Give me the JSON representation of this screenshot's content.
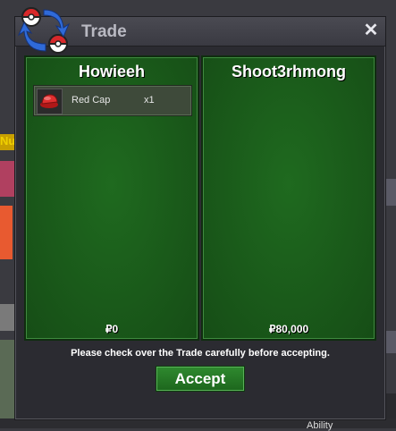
{
  "window": {
    "title": "Trade",
    "close_icon": "close-icon",
    "logo_icon": "trade-exchange-icon"
  },
  "trade": {
    "left": {
      "name": "Howieeh",
      "items": [
        {
          "name": "Red Cap",
          "quantity": "x1",
          "icon": "red-cap-icon"
        }
      ],
      "money": "₽0"
    },
    "right": {
      "name": "Shoot3rhmong",
      "items": [],
      "money": "₽80,000"
    }
  },
  "notice": "Please check over the Trade carefully before accepting.",
  "accept_label": "Accept",
  "background": {
    "left_fragment": "Nu",
    "bottom_fragment": "Ability"
  },
  "colors": {
    "panel_green": "#1a5a1a",
    "accept_green": "#2a7a2a",
    "title_text": "#b9b9c2"
  }
}
